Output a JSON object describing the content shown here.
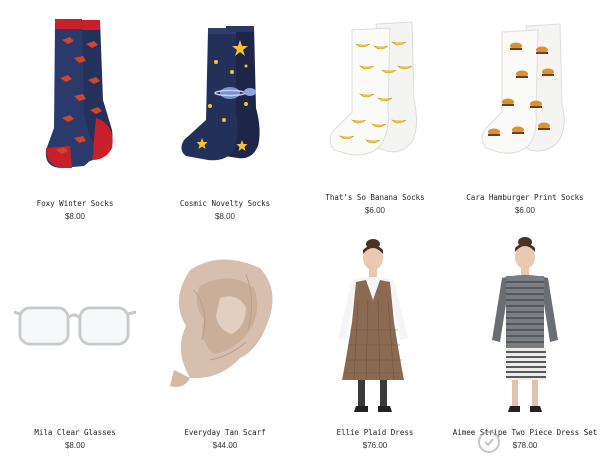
{
  "products": [
    {
      "name": "Foxy Winter Socks",
      "price": "$8.00",
      "icon": "fox-socks-image"
    },
    {
      "name": "Cosmic Novelty Socks",
      "price": "$8.00",
      "icon": "cosmic-socks-image"
    },
    {
      "name": "That’s So Banana Socks",
      "price": "$6.00",
      "icon": "banana-socks-image"
    },
    {
      "name": "Cara Hamburger Print Socks",
      "price": "$6.00",
      "icon": "hamburger-socks-image"
    },
    {
      "name": "Mila Clear Glasses",
      "price": "$8.00",
      "icon": "glasses-image"
    },
    {
      "name": "Everyday Tan Scarf",
      "price": "$44.00",
      "icon": "scarf-image"
    },
    {
      "name": "Ellie Plaid Dress",
      "price": "$76.00",
      "icon": "plaid-dress-image"
    },
    {
      "name": "Aimee Stripe Two Piece Dress Set",
      "price": "$78.00",
      "icon": "stripe-dress-image"
    }
  ]
}
